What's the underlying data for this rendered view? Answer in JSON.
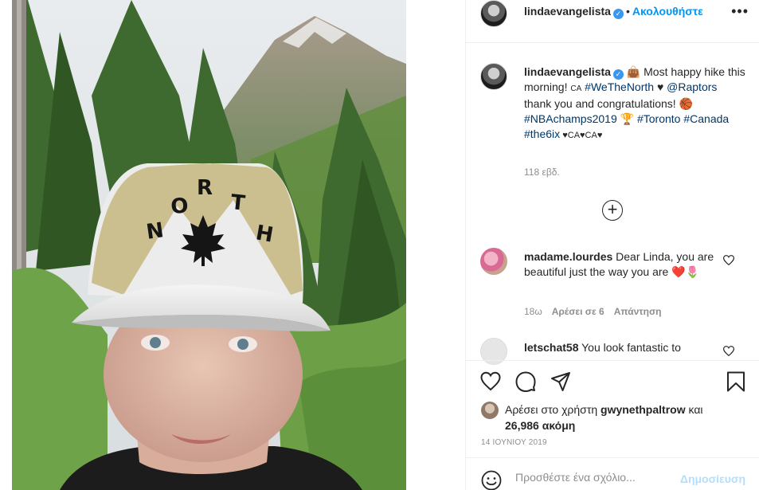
{
  "header": {
    "username": "lindaevangelista",
    "separator": "•",
    "follow_label": "Ακολουθήστε",
    "more_label": "•••"
  },
  "caption": {
    "username": "lindaevangelista",
    "text_1": " 👜 Most happy hike this morning! ",
    "flag_1": "CA",
    "hashtag_1": "#WeTheNorth",
    "text_2": " ♥ ",
    "mention": "@Raptors",
    "text_3": " thank you and congratulations! 🏀 ",
    "hashtag_2": "#NBAchamps2019",
    "text_4": " 🏆 ",
    "hashtag_3": "#Toronto",
    "hashtag_4": "#Canada",
    "hashtag_5": "#the6ix",
    "text_5": " ♥CA♥CA♥",
    "time": "118 εβδ."
  },
  "comments": [
    {
      "username": "madame.lourdes",
      "text": " Dear Linda, you are beautiful just the way you are ❤️🌷",
      "time": "18ω",
      "likes_label": "Αρέσει σε 6",
      "reply_label": "Απάντηση"
    },
    {
      "username": "letschat58",
      "text": " You look fantastic to"
    }
  ],
  "likes": {
    "prefix": "Αρέσει στο χρήστη ",
    "user": "gwynethpaltrow",
    "middle": " και",
    "count": "26,986 ακόμη"
  },
  "date": "14 ΙΟΥΝΙΟΥ 2019",
  "add_comment": {
    "placeholder": "Προσθέστε ένα σχόλιο...",
    "post_label": "Δημοσίευση"
  },
  "colors": {
    "accent": "#0095f6",
    "hashtag": "#00376b",
    "muted": "#8e8e8e",
    "post_disabled": "#b2dffc"
  }
}
